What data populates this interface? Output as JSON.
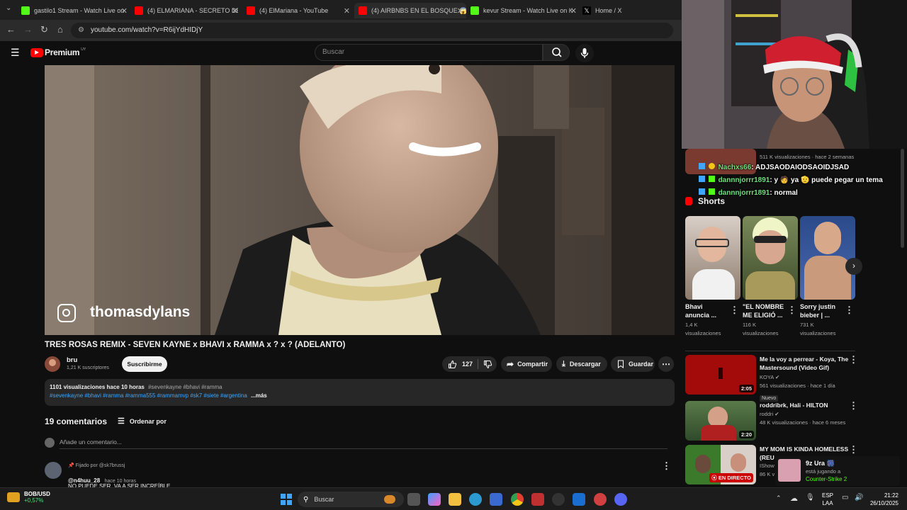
{
  "browser": {
    "tabs": [
      {
        "title": "gastilo1 Stream - Watch Live on",
        "color": "#53fc18"
      },
      {
        "title": "(4) ELMARIANA - SECRETO DE",
        "color": "#ff0000"
      },
      {
        "title": "(4) ElMariana - YouTube",
        "color": "#ff0000"
      },
      {
        "title": "(4) AIRBNBS EN EL BOSQUE 😱",
        "color": "#ff0000"
      },
      {
        "title": "kevur Stream - Watch Live on K",
        "color": "#53fc18"
      },
      {
        "title": "Home / X",
        "color": "#ffffff"
      }
    ],
    "url": "youtube.com/watch?v=R6ijYdHIDjY"
  },
  "youtube": {
    "logo_text": "Premium",
    "logo_region": "UY",
    "search_placeholder": "Buscar",
    "video_overlay_handle": "thomasdylans",
    "video_title": "TRES ROSAS REMIX - SEVEN KAYNE x BHAVI x RAMMA x ? x ? (ADELANTO)",
    "channel_name": "bru",
    "subscribers": "1,21 K suscriptores",
    "subscribe_label": "Suscribirme",
    "likes": "127",
    "share_label": "Compartir",
    "download_label": "Descargar",
    "save_label": "Guardar",
    "description": {
      "stats": "1101 visualizaciones  hace 10 horas",
      "tags_line1": "#sevenkayne #bhavi #ramma",
      "tags_line2": "#sevenkayne #bhavi #ramma #ramma555 #rammamvp #sk7 #siete #argentina",
      "more": "...más"
    },
    "comments": {
      "count_label": "19 comentarios",
      "sort_label": "Ordenar por",
      "add_placeholder": "Añade un comentario...",
      "pinned_label": "Fijado por @sk7brussj",
      "first_author": "@n4huu_28",
      "first_time": "hace 10 horas",
      "first_text": "NO PUEDE SER, VA A SER INCREÍBLE"
    },
    "sidebar": {
      "partial_meta": "511 K visualizaciones · hace 2 semanas",
      "shorts_label": "Shorts",
      "shorts": [
        {
          "title1": "Bhavi",
          "title2": "anuncia ...",
          "views1": "1,4 K",
          "views2": "visualizaciones"
        },
        {
          "title1": "\"EL NOMBRE",
          "title2": "ME ELIGIÓ ...",
          "views1": "116 K",
          "views2": "visualizaciones"
        },
        {
          "title1": "Sorry justin",
          "title2": "bieber | ...",
          "views1": "731 K",
          "views2": "visualizaciones"
        }
      ],
      "videos": [
        {
          "title1": "Me la voy a perrear - Koya, The",
          "title2": "Mastersound (Video Gif)",
          "channel": "KOYA",
          "meta": "561 visualizaciones · hace 1 día",
          "badge": "Nuevo",
          "duration": "2:05"
        },
        {
          "title1": "roddribrk, Hali - HILTON",
          "title2": "",
          "channel": "roddri",
          "meta": "48 K visualizaciones · hace 6 meses",
          "badge": "",
          "duration": "2:20"
        },
        {
          "title1": "MY MOM IS KINDA HOMELESS",
          "title2": "(REU",
          "channel": "IShow",
          "meta": "86 K v",
          "badge": "",
          "duration": "EN DIRECTO"
        }
      ]
    }
  },
  "stream_chat": [
    {
      "user": "Nachxs66",
      "message": ": ADJSAODAIODSAOIDJSAD"
    },
    {
      "user": "dannnjorrr1891",
      "message": ": y 🧑 ya 🫡 puede pegar un tema"
    },
    {
      "user": "dannnjorrr1891",
      "message": ": normal"
    }
  ],
  "stream_notification": {
    "name": "9z Ura 🎆",
    "status": "está jugando a",
    "game": "Counter-Strike 2"
  },
  "taskbar": {
    "ticker_name": "BOB/USD",
    "ticker_change": "+0,57%",
    "search_label": "Buscar",
    "lang1": "ESP",
    "lang2": "LAA",
    "time": "21:22",
    "date": "26/10/2025"
  }
}
